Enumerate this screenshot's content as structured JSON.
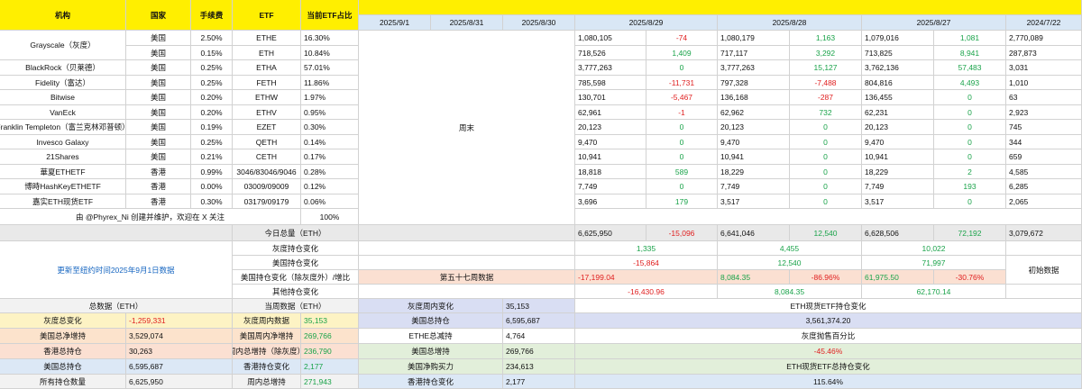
{
  "header": {
    "institution": "机构",
    "country": "国家",
    "fee": "手续费",
    "etf": "ETF",
    "share": "当前ETF占比",
    "dates": [
      "2025/9/1",
      "2025/8/31",
      "2025/8/30",
      "2025/8/29",
      "2025/8/28",
      "2025/8/27",
      "2024/7/22"
    ]
  },
  "rows": [
    {
      "name": "Grayscale（灰度）",
      "country": "美国",
      "fee": "2.50%",
      "etf": "ETHE",
      "share": "16.30%",
      "d29": "1,080,105",
      "c29": "-74",
      "d28": "1,080,179",
      "c28": "1,163",
      "d27": "1,079,016",
      "c27": "1,081",
      "d22": "2,770,089"
    },
    {
      "name": "",
      "country": "美国",
      "fee": "0.15%",
      "etf": "ETH",
      "share": "10.84%",
      "d29": "718,526",
      "c29": "1,409",
      "d28": "717,117",
      "c28": "3,292",
      "d27": "713,825",
      "c27": "8,941",
      "d22": "287,873"
    },
    {
      "name": "BlackRock（贝莱德）",
      "country": "美国",
      "fee": "0.25%",
      "etf": "ETHA",
      "share": "57.01%",
      "d29": "3,777,263",
      "c29": "0",
      "d28": "3,777,263",
      "c28": "15,127",
      "d27": "3,762,136",
      "c27": "57,483",
      "d22": "3,031"
    },
    {
      "name": "Fidelity（富达）",
      "country": "美国",
      "fee": "0.25%",
      "etf": "FETH",
      "share": "11.86%",
      "d29": "785,598",
      "c29": "-11,731",
      "d28": "797,328",
      "c28": "-7,488",
      "d27": "804,816",
      "c27": "4,493",
      "d22": "1,010"
    },
    {
      "name": "Bitwise",
      "country": "美国",
      "fee": "0.20%",
      "etf": "ETHW",
      "share": "1.97%",
      "d29": "130,701",
      "c29": "-5,467",
      "d28": "136,168",
      "c28": "-287",
      "d27": "136,455",
      "c27": "0",
      "d22": "63"
    },
    {
      "name": "VanEck",
      "country": "美国",
      "fee": "0.20%",
      "etf": "ETHV",
      "share": "0.95%",
      "d29": "62,961",
      "c29": "-1",
      "d28": "62,962",
      "c28": "732",
      "d27": "62,231",
      "c27": "0",
      "d22": "2,923"
    },
    {
      "name": "Franklin Templeton（富兰克林邓普顿）",
      "country": "美国",
      "fee": "0.19%",
      "etf": "EZET",
      "share": "0.30%",
      "d29": "20,123",
      "c29": "0",
      "d28": "20,123",
      "c28": "0",
      "d27": "20,123",
      "c27": "0",
      "d22": "745"
    },
    {
      "name": "Invesco Galaxy",
      "country": "美国",
      "fee": "0.25%",
      "etf": "QETH",
      "share": "0.14%",
      "d29": "9,470",
      "c29": "0",
      "d28": "9,470",
      "c28": "0",
      "d27": "9,470",
      "c27": "0",
      "d22": "344"
    },
    {
      "name": "21Shares",
      "country": "美国",
      "fee": "0.21%",
      "etf": "CETH",
      "share": "0.17%",
      "d29": "10,941",
      "c29": "0",
      "d28": "10,941",
      "c28": "0",
      "d27": "10,941",
      "c27": "0",
      "d22": "659"
    },
    {
      "name": "華夏ETHETF",
      "country": "香港",
      "fee": "0.99%",
      "etf": "3046/83046/9046",
      "share": "0.28%",
      "d29": "18,818",
      "c29": "589",
      "d28": "18,229",
      "c28": "0",
      "d27": "18,229",
      "c27": "2",
      "d22": "4,585"
    },
    {
      "name": "博時HashKeyETHETF",
      "country": "香港",
      "fee": "0.00%",
      "etf": "03009/09009",
      "share": "0.12%",
      "d29": "7,749",
      "c29": "0",
      "d28": "7,749",
      "c28": "0",
      "d27": "7,749",
      "c27": "193",
      "d22": "6,285"
    },
    {
      "name": "嘉实ETH现货ETF",
      "country": "香港",
      "fee": "0.30%",
      "etf": "03179/09179",
      "share": "0.06%",
      "d29": "3,696",
      "c29": "179",
      "d28": "3,517",
      "c28": "0",
      "d27": "3,517",
      "c27": "0",
      "d22": "2,065"
    }
  ],
  "credit": "由 @Phyrex_Ni 创建并维护，欢迎在 X 关注",
  "credit_pct": "100%",
  "weekend": "周末",
  "total_today": {
    "label": "今日总量（ETH）",
    "d29": "6,625,950",
    "c29": "-15,096",
    "d28": "6,641,046",
    "c28": "12,540",
    "d27": "6,628,506",
    "c27": "72,192",
    "d22": "3,079,672"
  },
  "updated": "更新至纽约时间2025年9月1日数据",
  "gray_change": {
    "label": "灰度持仓变化",
    "d29": "1,335",
    "d28": "4,455",
    "d27": "10,022"
  },
  "us_change": {
    "label": "美国持仓变化",
    "d29": "-15,864",
    "d28": "12,540",
    "d27": "71,997"
  },
  "us_ex_gray": {
    "label": "美国持仓变化（除灰度外）/增比",
    "week": "第五十七周数据",
    "v1": "-17,199.04",
    "v2": "8,084.35",
    "p2": "-86.96%",
    "v3": "61,975.50",
    "p3": "-30.76%",
    "initial": "初始数据"
  },
  "other_change": {
    "label": "其他持仓变化",
    "d29": "-16,430.96",
    "d28": "8,084.35",
    "d27": "62,170.14"
  },
  "summary": {
    "head_total": "总数据（ETH）",
    "head_cur": "当周数据（ETH）",
    "gray_total_label": "灰度总变化",
    "gray_total": "-1,259,331",
    "us_net_label": "美国总净增持",
    "us_net": "3,529,074",
    "hk_hold_label": "香港总持仓",
    "hk_hold": "30,263",
    "us_hold_label": "美国总持仓",
    "us_hold": "6,595,687",
    "all_hold_label": "所有持仓数量",
    "all_hold": "6,625,950",
    "gray_week_label": "灰度周内数据",
    "gray_week": "35,153",
    "us_week_label": "美国周内净增持",
    "us_week": "269,766",
    "week_total_label": "周内总增持（除灰度）",
    "week_total": "236,790",
    "hk_change_label": "香港持仓变化",
    "hk_change": "2,177",
    "week_all_label": "周内总增持",
    "week_all": "271,943",
    "g1_label": "灰度周内变化",
    "g1": "35,153",
    "g2_label": "美国总持仓",
    "g2": "6,595,687",
    "g3_label": "ETHE总减持",
    "g3": "4,764",
    "g4_label": "美国总增持",
    "g4": "269,766",
    "g5_label": "美国净购买力",
    "g5": "234,613",
    "g6_label": "香港持仓变化",
    "g6": "2,177",
    "r1": "ETH现货ETF持仓变化",
    "r2": "3,561,374.20",
    "r3": "灰度抛售百分比",
    "r4": "-45.46%",
    "r5": "ETH现货ETF总持仓变化",
    "r6": "115.64%"
  }
}
